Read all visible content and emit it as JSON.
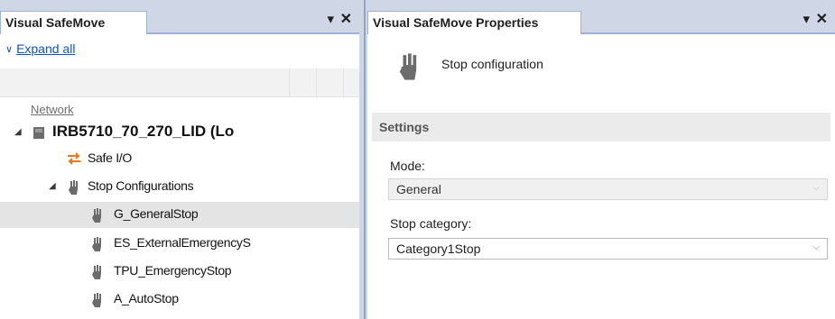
{
  "left_panel": {
    "title": "Visual SafeMove",
    "pin_glyph": "▾",
    "close_glyph": "✕",
    "expand_all": "Expand all",
    "network_label": "Network",
    "tree": {
      "robot": "IRB5710_70_270_LID (Lo",
      "safe_io": "Safe I/O",
      "stop_configurations": "Stop Configurations",
      "stops": [
        "G_GeneralStop",
        "ES_ExternalEmergencyS",
        "TPU_EmergencyStop",
        "A_AutoStop"
      ],
      "selected_index": 0
    }
  },
  "right_panel": {
    "title": "Visual SafeMove Properties",
    "pin_glyph": "▾",
    "close_glyph": "✕",
    "header_text": "Stop configuration",
    "settings_label": "Settings",
    "mode_label": "Mode:",
    "mode_value": "General",
    "stop_category_label": "Stop category:",
    "stop_category_value": "Category1Stop"
  },
  "icons": {
    "expand": "double-chevron-down-icon",
    "robot": "robot-controller-icon",
    "safe_io": "swap-arrows-icon",
    "stop": "stop-hand-icon"
  },
  "colors": {
    "link": "#0b54c7",
    "tab_border": "#9fb1d6",
    "title_bg": "#cfd6e6",
    "selected_row": "#e4e4e4",
    "safe_io_orange": "#e8781a",
    "hand_gray": "#6b6b6b"
  }
}
